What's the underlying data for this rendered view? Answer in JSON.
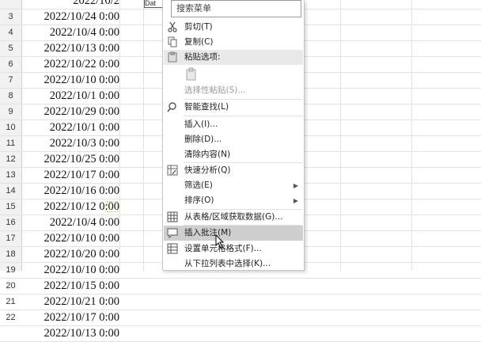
{
  "sheet": {
    "rows": [
      {
        "num": "",
        "value": "2022/10/2"
      },
      {
        "num": "3",
        "value": "2022/10/24 0:00"
      },
      {
        "num": "4",
        "value": "2022/10/4 0:00"
      },
      {
        "num": "5",
        "value": "2022/10/13 0:00"
      },
      {
        "num": "6",
        "value": "2022/10/22 0:00"
      },
      {
        "num": "7",
        "value": "2022/10/10 0:00"
      },
      {
        "num": "8",
        "value": "2022/10/1 0:00"
      },
      {
        "num": "9",
        "value": "2022/10/29 0:00"
      },
      {
        "num": "10",
        "value": "2022/10/1 0:00"
      },
      {
        "num": "11",
        "value": "2022/10/3 0:00"
      },
      {
        "num": "12",
        "value": "2022/10/25 0:00"
      },
      {
        "num": "13",
        "value": "2022/10/17 0:00"
      },
      {
        "num": "14",
        "value": "2022/10/16 0:00"
      },
      {
        "num": "15",
        "value": "2022/10/12 0:00"
      },
      {
        "num": "16",
        "value": "2022/10/4 0:00"
      },
      {
        "num": "17",
        "value": "2022/10/10 0:00"
      },
      {
        "num": "18",
        "value": "2022/10/20 0:00"
      },
      {
        "num": "19",
        "value": "2022/10/10 0:00"
      },
      {
        "num": "20",
        "value": "2022/10/15 0:00"
      },
      {
        "num": "21",
        "value": "2022/10/21 0:00"
      },
      {
        "num": "22",
        "value": "2022/10/17 0:00"
      },
      {
        "num": "",
        "value": "2022/10/13 0:00"
      }
    ],
    "colb_stub": "Dat"
  },
  "menu": {
    "search_placeholder": "搜索菜单",
    "cut": "剪切(T)",
    "copy": "复制(C)",
    "paste_options": "粘贴选项:",
    "paste_special": "选择性粘贴(S)...",
    "smart_lookup": "智能查找(L)",
    "insert": "插入(I)...",
    "delete": "删除(D)...",
    "clear_contents": "清除内容(N)",
    "quick_analysis": "快速分析(Q)",
    "filter": "筛选(E)",
    "sort": "排序(O)",
    "get_from_table": "从表格/区域获取数据(G)...",
    "insert_comment": "插入批注(M)",
    "format_cells": "设置单元格格式(F)...",
    "pick_from_list": "从下拉列表中选择(K)...",
    "submenu_arrow": "▶"
  },
  "icons": {
    "cut": "scissors-icon",
    "copy": "copy-icon",
    "paste": "clipboard-icon",
    "search": "magnifier-icon",
    "quick_analysis": "quick-analysis-icon",
    "table": "table-icon",
    "comment": "comment-icon",
    "format": "format-cells-icon"
  }
}
